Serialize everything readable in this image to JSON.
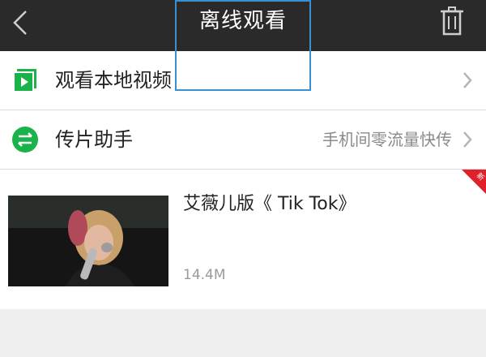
{
  "header": {
    "title": "离线观看",
    "back_icon": "chevron-left-icon",
    "delete_icon": "trash-icon"
  },
  "menu": {
    "local_videos": {
      "label": "观看本地视频",
      "icon": "play-folder-icon",
      "icon_color": "#19b34a"
    },
    "transfer_helper": {
      "label": "传片助手",
      "subtitle": "手机间零流量快传",
      "icon": "transfer-icon",
      "icon_color": "#19b34a"
    }
  },
  "video": {
    "title": "艾薇儿版《 Tik Tok》",
    "size": "14.4M",
    "badge": "新",
    "badge_color": "#e0202a"
  }
}
